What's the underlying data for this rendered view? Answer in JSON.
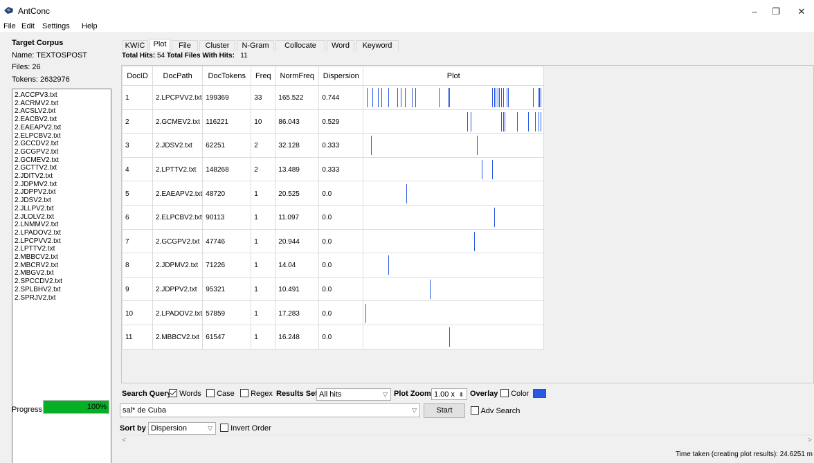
{
  "window": {
    "title": "AntConc",
    "minimize": "–",
    "restore": "❐",
    "close": "✕"
  },
  "menu": [
    "File",
    "Edit",
    "Settings",
    "Help"
  ],
  "corpus": {
    "heading": "Target Corpus",
    "name": "Name:  TEXTOSPOST",
    "files": "Files:   26",
    "tokens": "Tokens:  2632976",
    "file_list": [
      "2.ACCPV3.txt",
      "2.ACRMV2.txt",
      "2.ACSLV2.txt",
      "2.EACBV2.txt",
      "2.EAEAPV2.txt",
      "2.ELPCBV2.txt",
      "2.GCCDV2.txt",
      "2.GCGPV2.txt",
      "2.GCMEV2.txt",
      "2.GCTTV2.txt",
      "2.JDITV2.txt",
      "2.JDPMV2.txt",
      "2.JDPPV2.txt",
      "2.JDSV2.txt",
      "2.JLLPV2.txt",
      "2.JLOLV2.txt",
      "2.LNMMV2.txt",
      "2.LPADOV2.txt",
      "2.LPCPVV2.txt",
      "2.LPTTV2.txt",
      "2.MBBCV2.txt",
      "2.MBCRV2.txt",
      "2.MBGV2.txt",
      "2.SPCCDV2.txt",
      "2.SPLBHV2.txt",
      "2.SPRJV2.txt"
    ]
  },
  "progress": {
    "label": "Progress",
    "value": 1.0,
    "text": "100%"
  },
  "tabs": [
    "KWIC",
    "Plot",
    "File",
    "Cluster",
    "N-Gram",
    "Collocate",
    "Word",
    "Keyword"
  ],
  "active_tab": "Plot",
  "hits": {
    "total_hits_label": "Total Hits:",
    "total_hits": "54",
    "files_with_hits_label": "Total Files With Hits:",
    "files_with_hits": "11"
  },
  "table": {
    "headers": [
      "DocID",
      "DocPath",
      "DocTokens",
      "Freq",
      "NormFreq",
      "Dispersion",
      "Plot"
    ],
    "rows": [
      {
        "id": "1",
        "path": "2.LPCPVV2.txt",
        "tokens": "199369",
        "freq": "33",
        "norm": "165.522",
        "disp": "0.744",
        "plot": [
          0.02,
          0.05,
          0.08,
          0.1,
          0.14,
          0.19,
          0.21,
          0.23,
          0.27,
          0.29,
          0.42,
          0.47,
          0.48,
          0.72,
          0.73,
          0.74,
          0.75,
          0.76,
          0.77,
          0.78,
          0.8,
          0.81,
          0.95,
          0.98,
          0.985,
          0.99
        ]
      },
      {
        "id": "2",
        "path": "2.GCMEV2.txt",
        "tokens": "116221",
        "freq": "10",
        "norm": "86.043",
        "disp": "0.529",
        "plot": [
          0.58,
          0.6,
          0.77,
          0.78,
          0.79,
          0.86,
          0.92,
          0.96,
          0.98,
          0.99
        ]
      },
      {
        "id": "3",
        "path": "2.JDSV2.txt",
        "tokens": "62251",
        "freq": "2",
        "norm": "32.128",
        "disp": "0.333",
        "plot": [
          0.04,
          0.635
        ]
      },
      {
        "id": "4",
        "path": "2.LPTTV2.txt",
        "tokens": "148268",
        "freq": "2",
        "norm": "13.489",
        "disp": "0.333",
        "plot": [
          0.66,
          0.72
        ]
      },
      {
        "id": "5",
        "path": "2.EAEAPV2.txt",
        "tokens": "48720",
        "freq": "1",
        "norm": "20.525",
        "disp": "0.0",
        "plot": [
          0.24
        ]
      },
      {
        "id": "6",
        "path": "2.ELPCBV2.txt",
        "tokens": "90113",
        "freq": "1",
        "norm": "11.097",
        "disp": "0.0",
        "plot": [
          0.73
        ]
      },
      {
        "id": "7",
        "path": "2.GCGPV2.txt",
        "tokens": "47746",
        "freq": "1",
        "norm": "20.944",
        "disp": "0.0",
        "plot": [
          0.62
        ]
      },
      {
        "id": "8",
        "path": "2.JDPMV2.txt",
        "tokens": "71226",
        "freq": "1",
        "norm": "14.04",
        "disp": "0.0",
        "plot": [
          0.14
        ]
      },
      {
        "id": "9",
        "path": "2.JDPPV2.txt",
        "tokens": "95321",
        "freq": "1",
        "norm": "10.491",
        "disp": "0.0",
        "plot": [
          0.37
        ]
      },
      {
        "id": "10",
        "path": "2.LPADOV2.txt",
        "tokens": "57859",
        "freq": "1",
        "norm": "17.283",
        "disp": "0.0",
        "plot": [
          0.01
        ]
      },
      {
        "id": "11",
        "path": "2.MBBCV2.txt",
        "tokens": "61547",
        "freq": "1",
        "norm": "16.248",
        "disp": "0.0",
        "plot": [
          0.48
        ]
      }
    ]
  },
  "plot_color": "#2859e0",
  "search": {
    "query_label": "Search Query",
    "words_label": "Words",
    "case_label": "Case",
    "regex_label": "Regex",
    "results_set_label": "Results Set",
    "results_set_value": "All hits",
    "plot_zoom_label": "Plot Zoom",
    "plot_zoom_value": "1.00 x",
    "overlay_label": "Overlay",
    "color_label": "Color",
    "query_value": "sal* de Cuba",
    "start_label": "Start",
    "adv_search_label": "Adv Search",
    "sort_by_label": "Sort by",
    "sort_by_value": "Dispersion",
    "invert_order_label": "Invert Order"
  },
  "status": "Time taken (creating plot results):  24.6251 m"
}
